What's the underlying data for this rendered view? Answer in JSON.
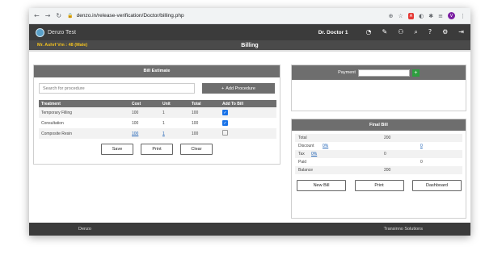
{
  "browser": {
    "url": "denzo.in/release-verification/Doctor/billing.php",
    "back_icon": "back-arrow-icon",
    "forward_icon": "forward-arrow-icon",
    "reload_icon": "reload-icon",
    "avatar_letter": "V"
  },
  "app": {
    "brand": "Denzo Test",
    "doctor": "Dr. Doctor 1",
    "nav_icons": [
      "dashboard-gauge-icon",
      "tooth-icon",
      "patient-icon",
      "search-icon",
      "help-icon",
      "settings-icon",
      "logout-icon"
    ]
  },
  "subbar": {
    "patient": "Mr. Ashrf Vm : 48 (Male)",
    "title": "Billing"
  },
  "estimate": {
    "title": "Bill Estimate",
    "search_placeholder": "Search for procedure",
    "add_label": "Add Procedure",
    "columns": [
      "Treatment",
      "Cost",
      "Unit",
      "Total",
      "Add To Bill"
    ],
    "rows": [
      {
        "treatment": "Temporary Filling",
        "cost": "100",
        "unit": "1",
        "total": "100",
        "checked": true
      },
      {
        "treatment": "Consultation",
        "cost": "100",
        "unit": "1",
        "total": "100",
        "checked": true
      },
      {
        "treatment": "Composite Resin",
        "cost": "100",
        "unit": "1",
        "total": "100",
        "checked": false
      }
    ],
    "buttons": {
      "save": "Save",
      "print": "Print",
      "clear": "Clear"
    }
  },
  "payment": {
    "label": "Payment",
    "value": ""
  },
  "final_bill": {
    "title": "Final Bill",
    "total_label": "Total",
    "total_value": "200",
    "discount_label": "Discount",
    "discount_pct": "0%",
    "discount_value": "0",
    "tax_label": "Tax",
    "tax_pct": "0%",
    "tax_value": "0",
    "paid_label": "Paid",
    "paid_value": "0",
    "balance_label": "Balance",
    "balance_value": "200",
    "buttons": {
      "new_bill": "New Bill",
      "print": "Print",
      "dashboard": "Dashboard"
    }
  },
  "footer": {
    "left": "Denzo",
    "right": "Transinno Solutions"
  }
}
